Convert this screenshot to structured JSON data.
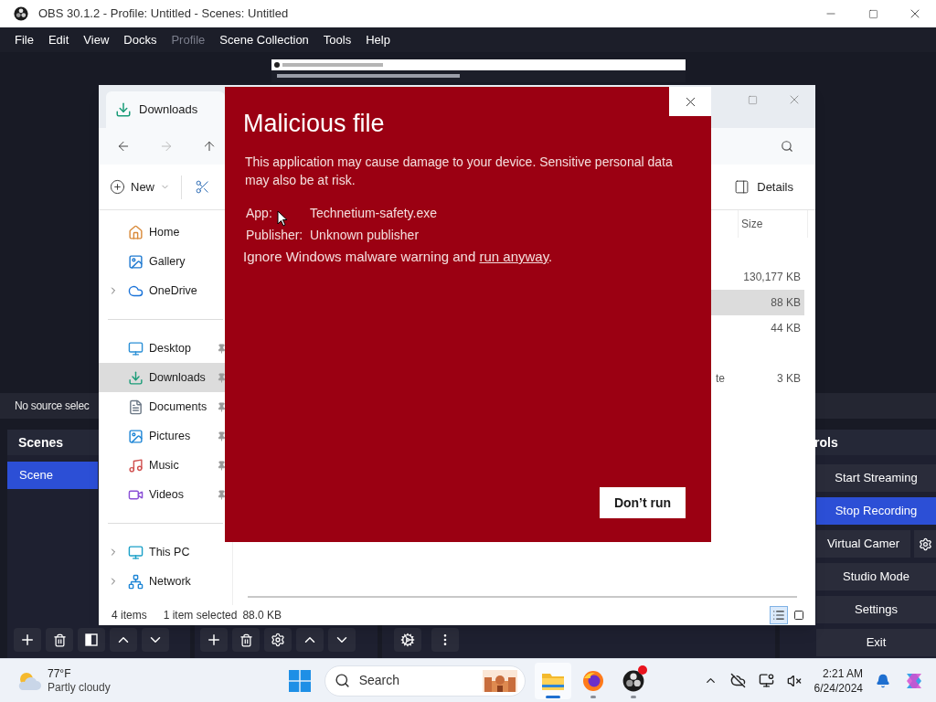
{
  "obs": {
    "title": "OBS 30.1.2 - Profile: Untitled - Scenes: Untitled",
    "menu": [
      {
        "label": "File",
        "disabled": false
      },
      {
        "label": "Edit",
        "disabled": false
      },
      {
        "label": "View",
        "disabled": false
      },
      {
        "label": "Docks",
        "disabled": false
      },
      {
        "label": "Profile",
        "disabled": true
      },
      {
        "label": "Scene Collection",
        "disabled": false
      },
      {
        "label": "Tools",
        "disabled": false
      },
      {
        "label": "Help",
        "disabled": false
      }
    ],
    "source_bar": "No source selec",
    "scenes": {
      "title": "Scenes",
      "items": [
        {
          "label": "Scene",
          "selected": true
        }
      ]
    },
    "controls": {
      "title": "rols",
      "buttons": [
        {
          "kind": "plain",
          "label": "Start Streaming",
          "active": false
        },
        {
          "kind": "plain",
          "label": "Stop Recording",
          "active": true
        },
        {
          "kind": "split",
          "label": "Virtual Camer",
          "active": false
        },
        {
          "kind": "plain",
          "label": "Studio Mode",
          "active": false
        },
        {
          "kind": "plain",
          "label": "Settings",
          "active": false
        },
        {
          "kind": "plain",
          "label": "Exit",
          "active": false
        }
      ]
    }
  },
  "explorer": {
    "tab": "Downloads",
    "new_label": "New",
    "details_label": "Details",
    "nav_sections": [
      [
        {
          "label": "Home",
          "kind": "home",
          "expandable": false,
          "pinned": false,
          "selected": false
        },
        {
          "label": "Gallery",
          "kind": "gallery",
          "expandable": false,
          "pinned": false,
          "selected": false
        },
        {
          "label": "OneDrive",
          "kind": "cloud",
          "expandable": true,
          "pinned": false,
          "selected": false
        }
      ],
      [
        {
          "label": "Desktop",
          "kind": "desktop",
          "expandable": false,
          "pinned": true,
          "selected": false
        },
        {
          "label": "Downloads",
          "kind": "download",
          "expandable": false,
          "pinned": true,
          "selected": true
        },
        {
          "label": "Documents",
          "kind": "document",
          "expandable": false,
          "pinned": true,
          "selected": false
        },
        {
          "label": "Pictures",
          "kind": "pictures",
          "expandable": false,
          "pinned": true,
          "selected": false
        },
        {
          "label": "Music",
          "kind": "music",
          "expandable": false,
          "pinned": true,
          "selected": false
        },
        {
          "label": "Videos",
          "kind": "videos",
          "expandable": false,
          "pinned": true,
          "selected": false
        }
      ],
      [
        {
          "label": "This PC",
          "kind": "pc",
          "expandable": true,
          "pinned": false,
          "selected": false
        },
        {
          "label": "Network",
          "kind": "network",
          "expandable": true,
          "pinned": false,
          "selected": false
        }
      ]
    ],
    "size_header": "Size",
    "row_groups": [
      [
        {
          "size": "130,177 KB",
          "selected": false
        },
        {
          "size": "88 KB",
          "selected": true
        },
        {
          "size": "44 KB",
          "selected": false
        }
      ],
      [
        {
          "fragment": "te",
          "size": "3 KB",
          "selected": false
        }
      ]
    ],
    "status_count": "4 items",
    "status_selection": "1 item selected",
    "status_size": "88.0 KB",
    "views": [
      {
        "kind": "details",
        "selected": true
      },
      {
        "kind": "tiles",
        "selected": false
      }
    ]
  },
  "dialog": {
    "title": "Malicious file",
    "message": "This application may cause damage to your device. Sensitive personal data may also be at risk.",
    "app_label": "App:",
    "app": "Technetium-safety.exe",
    "publisher_label": "Publisher:",
    "publisher": "Unknown publisher",
    "warning_prefix": "Ignore Windows malware warning and",
    "link": "run anyway",
    "warning_suffix": ".",
    "button": "Don’t run"
  },
  "taskbar": {
    "temperature": "77°F",
    "condition": "Partly cloudy",
    "search_label": "Search",
    "apps": [
      {
        "kind": "explorer",
        "active": true,
        "badge": false
      },
      {
        "kind": "firefox",
        "active": false,
        "badge": false
      },
      {
        "kind": "obs",
        "active": false,
        "badge": true
      }
    ],
    "time": "2:21 AM",
    "date": "6/24/2024"
  }
}
